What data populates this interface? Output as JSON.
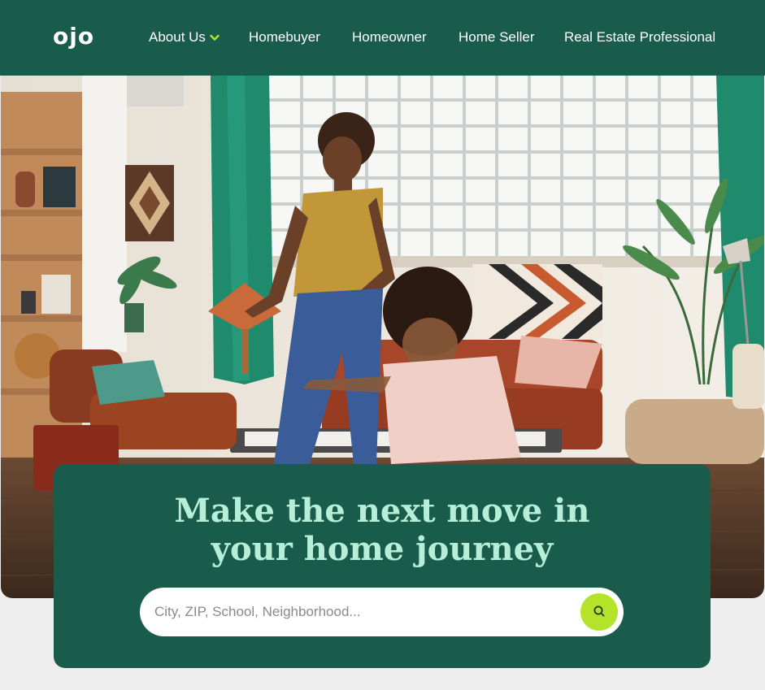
{
  "header": {
    "logo": "ojo",
    "nav": [
      {
        "label": "About Us",
        "has_dropdown": true
      },
      {
        "label": "Homebuyer"
      },
      {
        "label": "Homeowner"
      },
      {
        "label": "Home Seller"
      },
      {
        "label": "Real Estate Professional"
      }
    ]
  },
  "hero": {
    "headline_line1": "Make the next move in",
    "headline_line2": "your home journey",
    "search": {
      "placeholder": "City, ZIP, School, Neighborhood...",
      "button_icon": "search-icon"
    },
    "image_subject": "photo"
  },
  "colors": {
    "brand_green": "#195c4b",
    "headline_mint": "#b7eed8",
    "accent_lime": "#b4e32a",
    "page_background": "#eeeeee",
    "dropdown_chevron": "#b4e32a"
  }
}
